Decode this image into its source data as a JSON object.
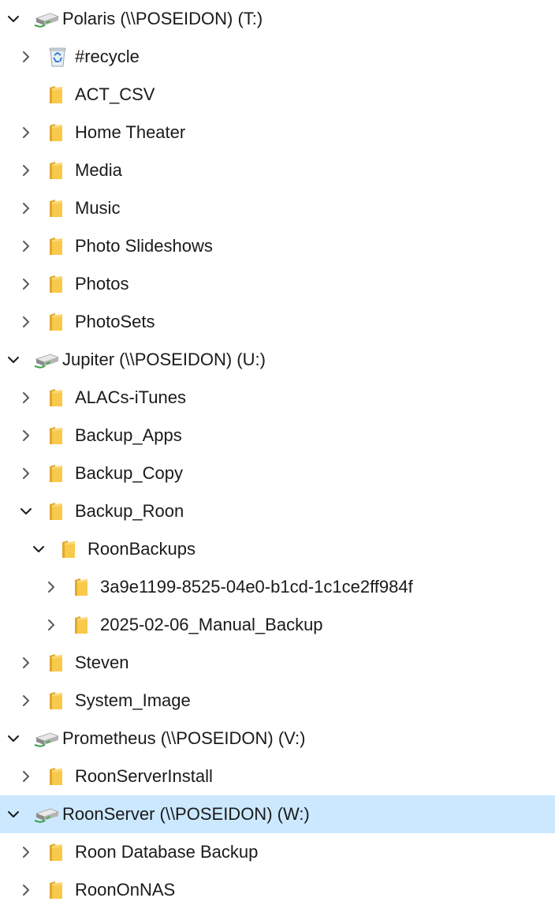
{
  "tree": [
    {
      "label": "Polaris (\\\\POSEIDON) (T:)",
      "level": 0,
      "chevron": "expanded",
      "icon": "network-drive-icon"
    },
    {
      "label": "#recycle",
      "level": 1,
      "chevron": "collapsed",
      "icon": "recycle-bin-icon"
    },
    {
      "label": "ACT_CSV",
      "level": 1,
      "chevron": "none",
      "icon": "folder-icon"
    },
    {
      "label": "Home Theater",
      "level": 1,
      "chevron": "collapsed",
      "icon": "folder-icon"
    },
    {
      "label": "Media",
      "level": 1,
      "chevron": "collapsed",
      "icon": "folder-icon"
    },
    {
      "label": "Music",
      "level": 1,
      "chevron": "collapsed",
      "icon": "folder-icon"
    },
    {
      "label": "Photo Slideshows",
      "level": 1,
      "chevron": "collapsed",
      "icon": "folder-icon"
    },
    {
      "label": "Photos",
      "level": 1,
      "chevron": "collapsed",
      "icon": "folder-icon"
    },
    {
      "label": "PhotoSets",
      "level": 1,
      "chevron": "collapsed",
      "icon": "folder-icon"
    },
    {
      "label": "Jupiter (\\\\POSEIDON) (U:)",
      "level": 0,
      "chevron": "expanded",
      "icon": "network-drive-icon"
    },
    {
      "label": "ALACs-iTunes",
      "level": 1,
      "chevron": "collapsed",
      "icon": "folder-icon"
    },
    {
      "label": "Backup_Apps",
      "level": 1,
      "chevron": "collapsed",
      "icon": "folder-icon"
    },
    {
      "label": "Backup_Copy",
      "level": 1,
      "chevron": "collapsed",
      "icon": "folder-icon"
    },
    {
      "label": "Backup_Roon",
      "level": 1,
      "chevron": "expanded",
      "icon": "folder-icon"
    },
    {
      "label": "RoonBackups",
      "level": 2,
      "chevron": "expanded",
      "icon": "folder-icon"
    },
    {
      "label": "3a9e1199-8525-04e0-b1cd-1c1ce2ff984f",
      "level": 3,
      "chevron": "collapsed",
      "icon": "folder-icon"
    },
    {
      "label": "2025-02-06_Manual_Backup",
      "level": 3,
      "chevron": "collapsed",
      "icon": "folder-icon"
    },
    {
      "label": "Steven",
      "level": 1,
      "chevron": "collapsed",
      "icon": "folder-icon"
    },
    {
      "label": "System_Image",
      "level": 1,
      "chevron": "collapsed",
      "icon": "folder-icon"
    },
    {
      "label": "Prometheus (\\\\POSEIDON) (V:)",
      "level": 0,
      "chevron": "expanded",
      "icon": "network-drive-icon"
    },
    {
      "label": "RoonServerInstall",
      "level": 1,
      "chevron": "collapsed",
      "icon": "folder-icon"
    },
    {
      "label": "RoonServer (\\\\POSEIDON) (W:)",
      "level": 0,
      "chevron": "expanded",
      "icon": "network-drive-icon",
      "selected": true
    },
    {
      "label": "Roon Database Backup",
      "level": 1,
      "chevron": "collapsed",
      "icon": "folder-icon"
    },
    {
      "label": "RoonOnNAS",
      "level": 1,
      "chevron": "collapsed",
      "icon": "folder-icon"
    }
  ],
  "colors": {
    "selection": "#cce8ff",
    "folder": "#f8c94a",
    "chevron": "#5a5a5a"
  }
}
